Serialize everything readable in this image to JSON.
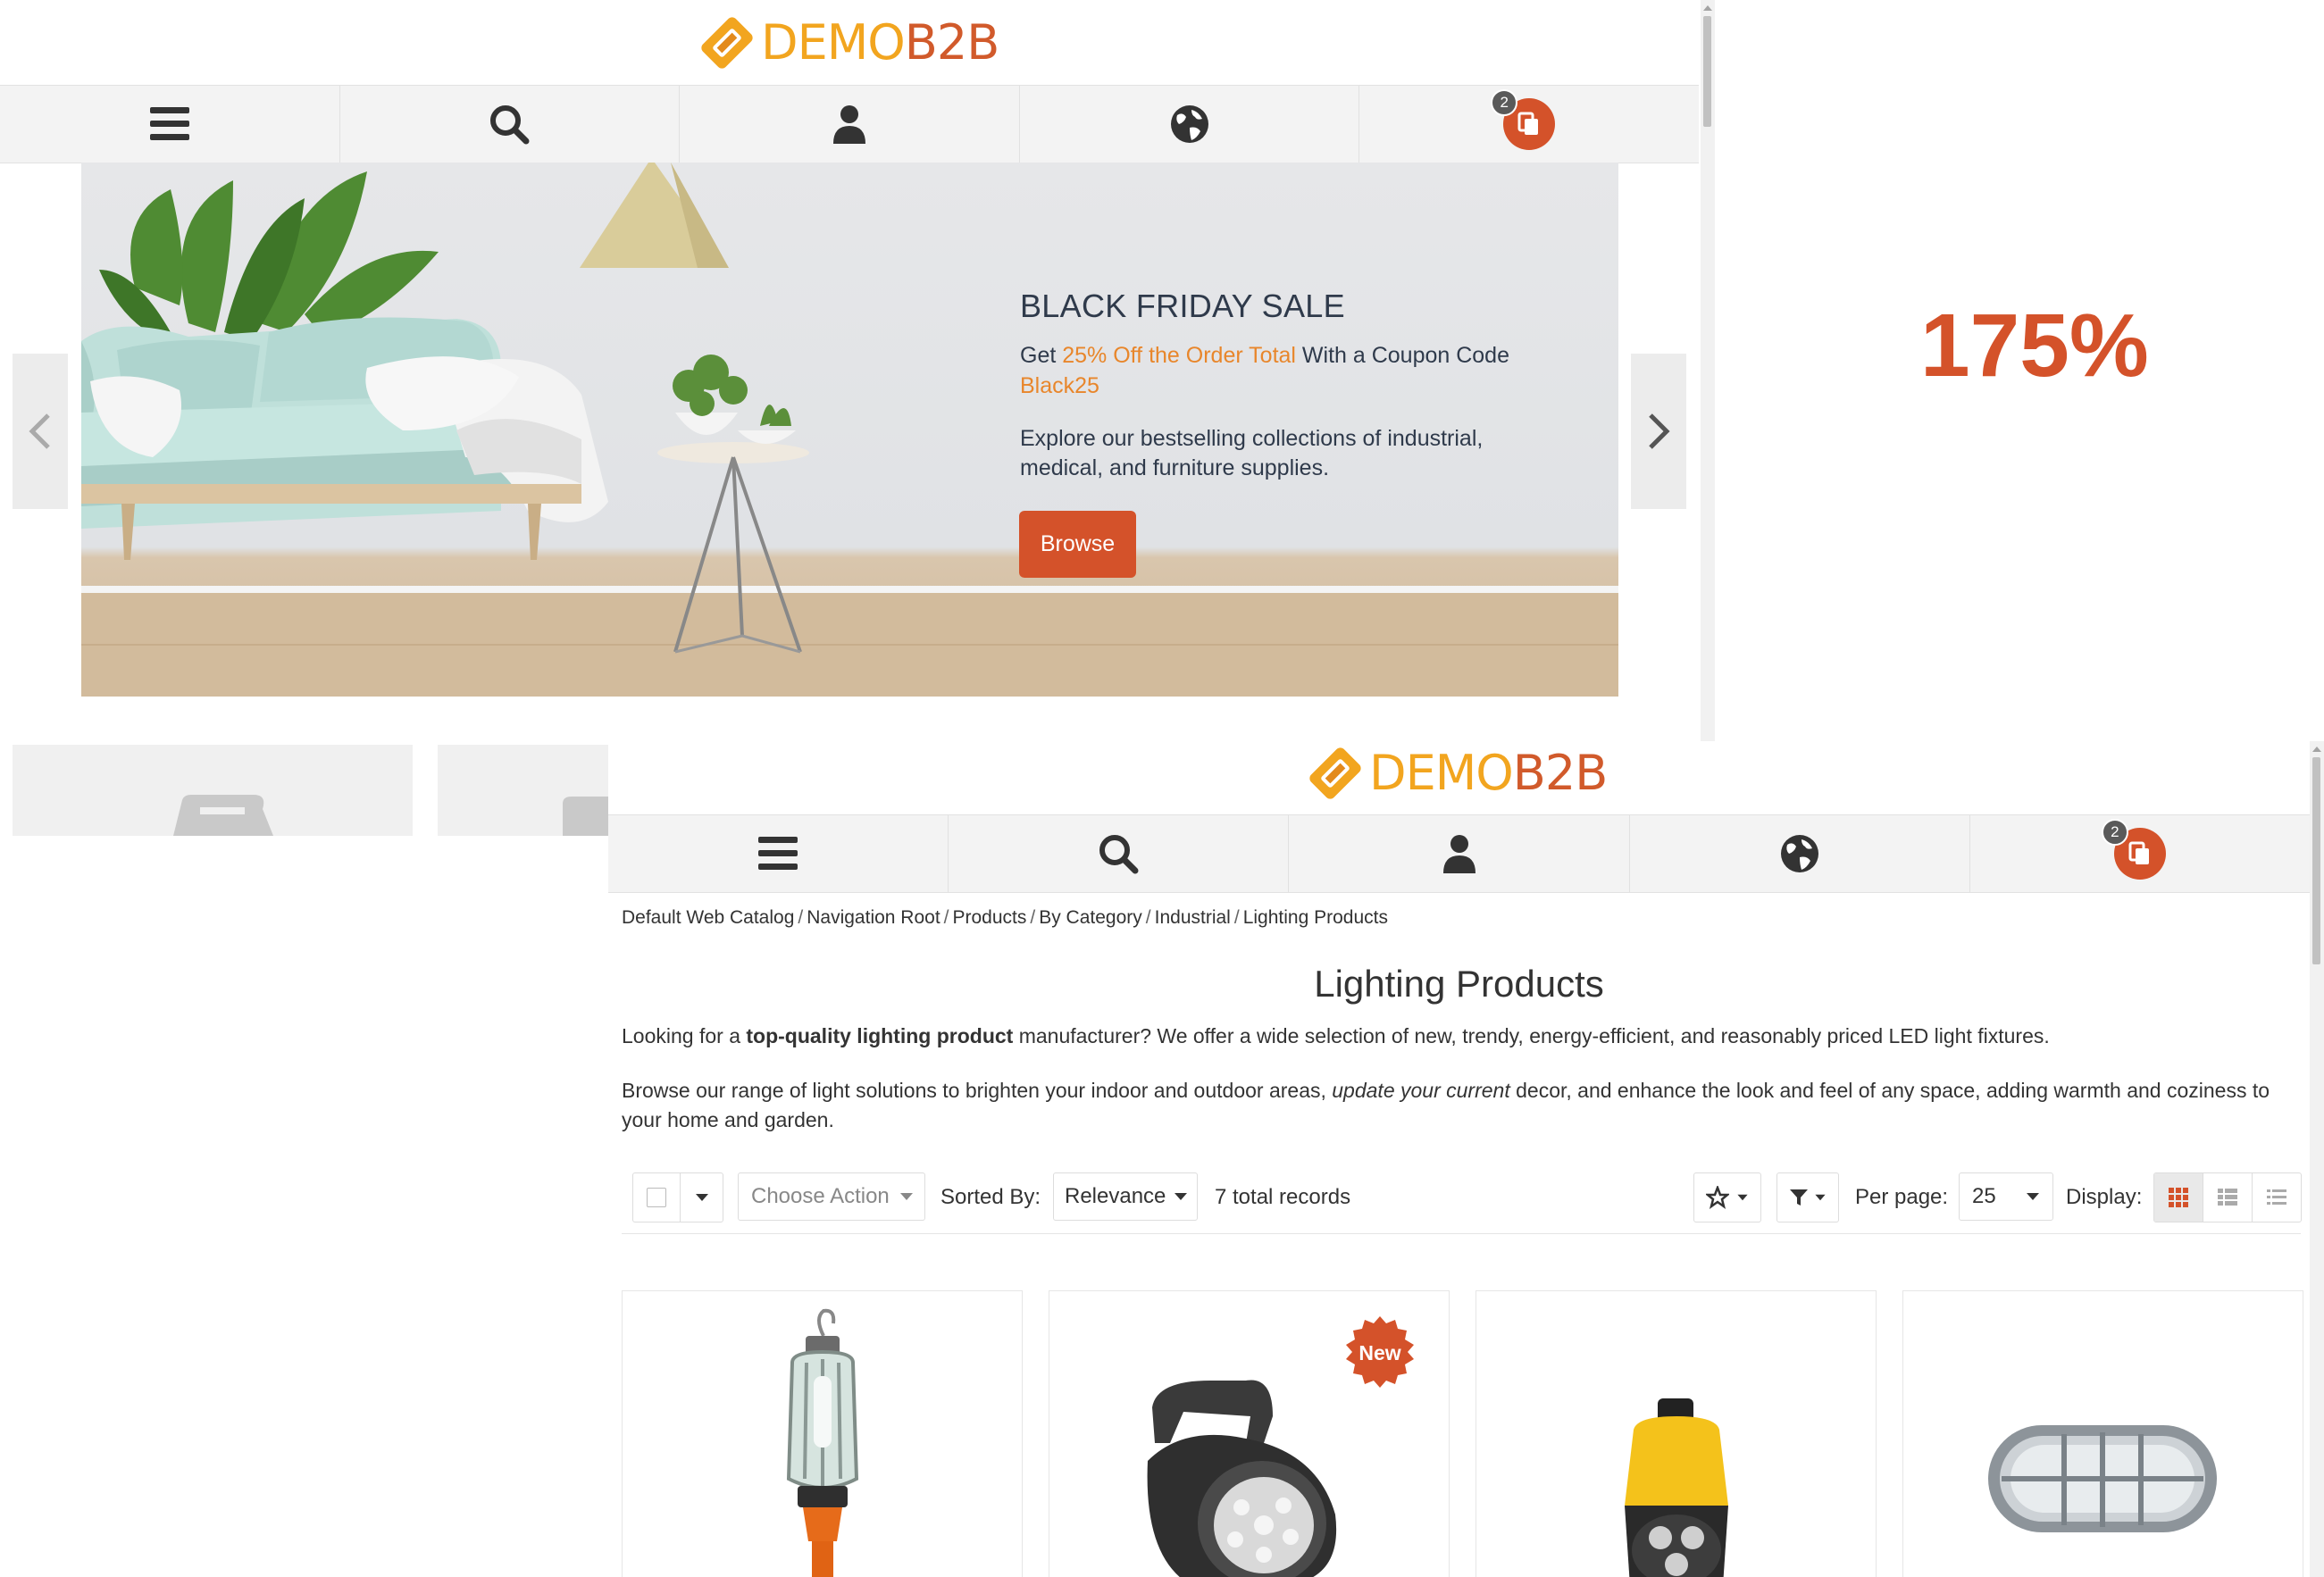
{
  "back_window": {
    "logo": {
      "demo": "DEMO",
      "b2b": "B2B"
    },
    "cart_count": "2",
    "hero": {
      "title": "BLACK FRIDAY SALE",
      "get": "Get ",
      "highlight": "25% Off the Order Total",
      "with_coupon": " With a Coupon Code ",
      "coupon": "Black25",
      "description": "Explore our bestselling collections of industrial, medical, and furniture supplies.",
      "button": "Browse"
    },
    "zoom_level": "175%"
  },
  "front_window": {
    "logo": {
      "demo": "DEMO",
      "b2b": "B2B"
    },
    "cart_count": "2",
    "breadcrumb": [
      "Default Web Catalog",
      "Navigation Root",
      "Products",
      "By Category",
      "Industrial",
      "Lighting Products"
    ],
    "breadcrumb_sep": "/",
    "page_title": "Lighting Products",
    "intro": {
      "p1_a": "Looking for a ",
      "p1_bold": "top-quality lighting product",
      "p1_b": " manufacturer? We offer a wide selection of new, trendy, energy-efficient, and reasonably priced LED light fixtures.",
      "p2_a": "Browse our range of light solutions to brighten your indoor and outdoor areas, ",
      "p2_italic": "update your current",
      "p2_b": " decor, and enhance the look and feel of any space, adding warmth and coziness to your home and garden."
    },
    "toolbar": {
      "choose_action": "Choose Action",
      "sorted_by_label": "Sorted By:",
      "sort_value": "Relevance",
      "total_records": "7 total records",
      "per_page_label": "Per page:",
      "per_page_value": "25",
      "display_label": "Display:"
    },
    "product_badge": "New",
    "icons": [
      "menu-icon",
      "search-icon",
      "user-icon",
      "globe-icon",
      "cart-icon",
      "star-icon",
      "filter-icon",
      "grid-view-icon",
      "list-view-icon",
      "compact-list-icon"
    ],
    "colors": {
      "accent": "#d4522a",
      "logo_yellow": "#f2a51f",
      "highlight": "#e8862b"
    }
  }
}
